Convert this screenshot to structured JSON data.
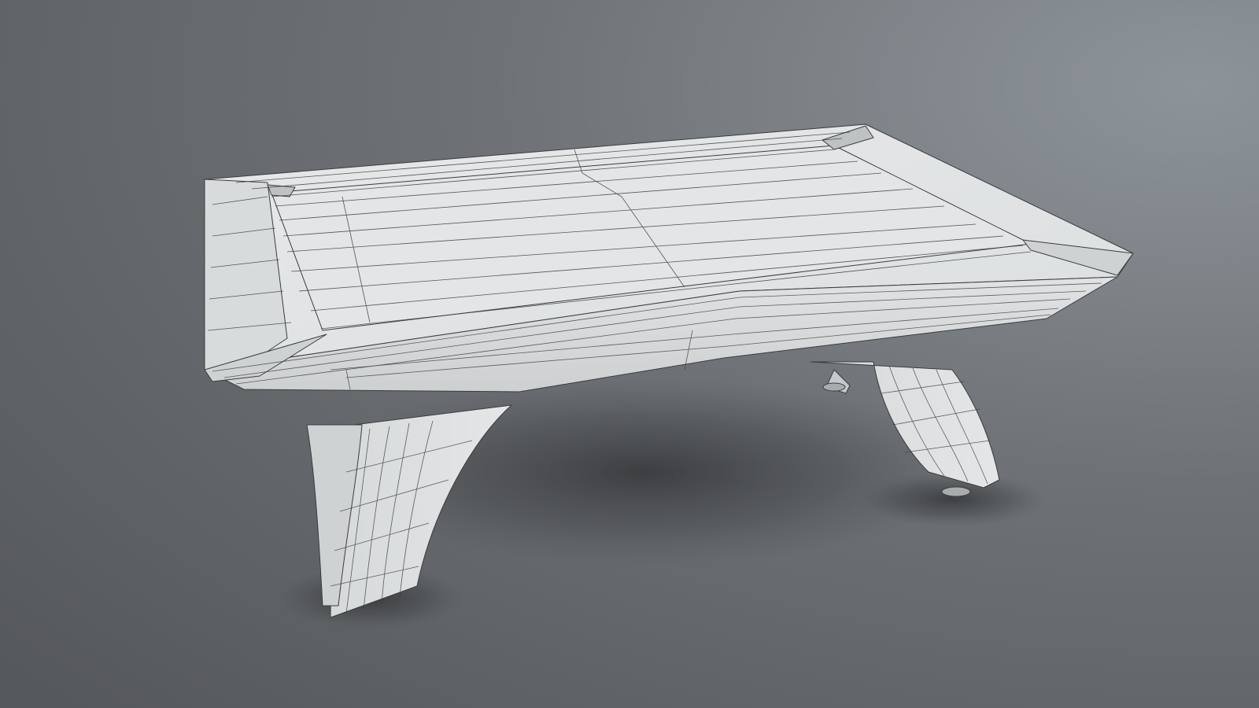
{
  "scene": {
    "subject": "pool-table-wireframe",
    "background_colors": {
      "light": "#8a9196",
      "mid": "#6c7074",
      "dark": "#55585b"
    },
    "model_fill": "#e2e4e5",
    "model_shade": "#c9cccd",
    "wire_color": "#3a3c3e",
    "shadow_color": "#2f3133"
  }
}
